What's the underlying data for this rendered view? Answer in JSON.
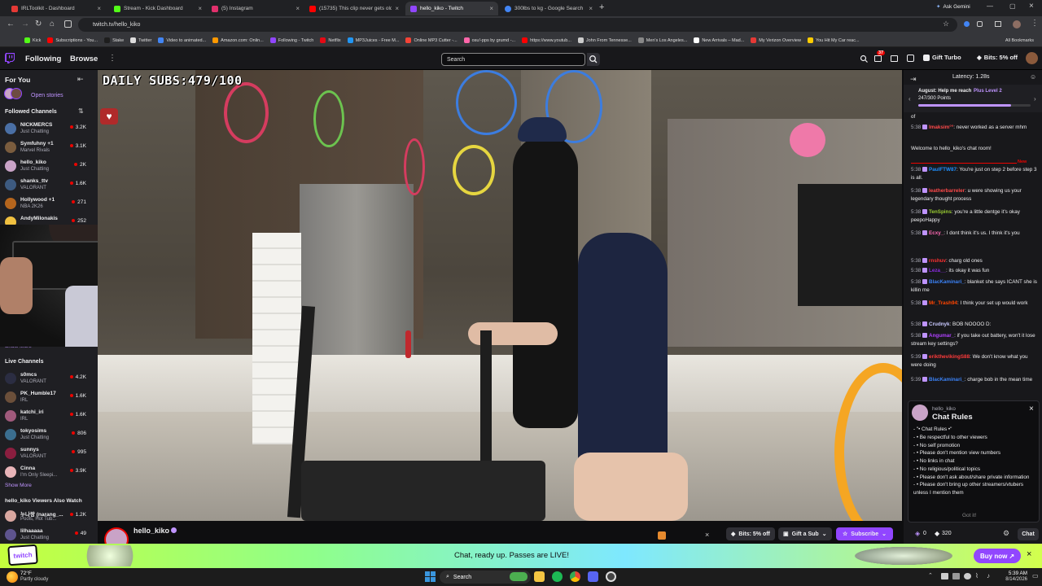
{
  "browser": {
    "tabs": [
      {
        "title": "IRLToolkit - Dashboard",
        "color": "#e53935"
      },
      {
        "title": "Stream - Kick Dashboard",
        "color": "#53fc18"
      },
      {
        "title": "(5) Instagram",
        "color": "#e1306c"
      },
      {
        "title": "(15735) This clip never gets old",
        "color": "#ff0000"
      },
      {
        "title": "hello_kiko - Twitch",
        "color": "#9146ff"
      },
      {
        "title": "300lbs to kg - Google Search",
        "color": "#4285f4"
      }
    ],
    "ask_gemini": "Ask Gemini",
    "url": "twitch.tv/hello_kiko",
    "bookmarks": [
      "Kick",
      "Subscriptions - You...",
      "Stake",
      "Twitter",
      "Video to animated...",
      "Amazon.com: Onlin...",
      "Following - Twitch",
      "Netflix",
      "MP3Juices - Free M...",
      "Online MP3 Cutter -...",
      "osu!-pps by grumd -...",
      "https://www.youtub...",
      "John From Tennesse...",
      "Men's Los Angeles...",
      "New Arrivals – Mad...",
      "My Verizon Overview",
      "You Hit My Car reac..."
    ],
    "all_bookmarks": "All Bookmarks"
  },
  "twitch_nav": {
    "following": "Following",
    "browse": "Browse",
    "search_placeholder": "Search",
    "notification_count": "37",
    "gift_turbo": "Gift Turbo",
    "bits_offer": "Bits: 5% off"
  },
  "sidebar": {
    "for_you": "For You",
    "open_stories": "Open stories",
    "followed_channels": "Followed Channels",
    "followed": [
      {
        "name": "NICKMERCS",
        "game": "Just Chatting",
        "viewers": "3.2K",
        "color": "#4a6fa5"
      },
      {
        "name": "Symfuhny +1",
        "game": "Marvel Rivals",
        "viewers": "3.1K",
        "color": "#7a5c3e"
      },
      {
        "name": "hello_kiko",
        "game": "Just Chatting",
        "viewers": "2K",
        "color": "#c9a3c7"
      },
      {
        "name": "shanks_ttv",
        "game": "VALORANT",
        "viewers": "1.6K",
        "color": "#3d5a80"
      },
      {
        "name": "Hollywood +1",
        "game": "NBA 2K26",
        "viewers": "271",
        "color": "#b5651d"
      },
      {
        "name": "AndyMilonakis",
        "game": "",
        "viewers": "252",
        "color": "#f0c040"
      }
    ],
    "show_more": "Show More",
    "live_channels": "Live Channels",
    "live": [
      {
        "name": "s0mcs",
        "game": "VALORANT",
        "viewers": "4.2K",
        "color": "#2b2d42"
      },
      {
        "name": "PK_Humble17",
        "game": "IRL",
        "viewers": "1.6K",
        "color": "#6b4f3a"
      },
      {
        "name": "katchi_iri",
        "game": "IRL",
        "viewers": "1.6K",
        "color": "#a05a7c"
      },
      {
        "name": "tokyosims",
        "game": "Just Chatting",
        "viewers": "806",
        "color": "#3b6e8f"
      },
      {
        "name": "sunnys",
        "game": "VALORANT",
        "viewers": "995",
        "color": "#8b1e3f"
      },
      {
        "name": "Cinna",
        "game": "I'm Only Sleepi...",
        "viewers": "3.9K",
        "color": "#e8b4b8"
      }
    ],
    "show_more_2": "Show More",
    "viewers_also_watch": "hello_kiko Viewers Also Watch",
    "also": [
      {
        "name": "누나랑 (narang_...",
        "game": "Pools, Hot Tub...",
        "viewers": "1.2K",
        "color": "#d9a7a0"
      },
      {
        "name": "lilhaaaaa",
        "game": "Just Chatting",
        "viewers": "49",
        "color": "#5e548e"
      }
    ]
  },
  "video": {
    "overlay_subs": "DAILY SUBS:479/100"
  },
  "stream_info": {
    "channel": "hello_kiko",
    "bits_offer": "Bits: 5% off",
    "gift_sub": "Gift a Sub",
    "subscribe": "Subscribe"
  },
  "chat": {
    "latency": "Latency: 1.28s",
    "goal_title": "August: Help me reach",
    "goal_level": "Plus Level 2",
    "goal_points": "247/300 Points",
    "goal_progress": 0.823,
    "of": "of",
    "messages": [
      {
        "time": "5:38",
        "user": "lmaksim°°",
        "color": "#ff4a4a",
        "text": ": never worked as a server mhm"
      },
      {
        "time": "",
        "user": "",
        "color": "#efeff1",
        "text": "Welcome to hello_kiko's chat room!"
      },
      {
        "time": "5:38",
        "user": "PaulFTW87",
        "color": "#1e90ff",
        "text": ": You're just on step 2 before step 3 is all."
      },
      {
        "time": "5:38",
        "user": "leatherbarreler",
        "color": "#ff4a4a",
        "text": ": u were showing us your legendary thought process"
      },
      {
        "time": "5:38",
        "user": "TenSpins",
        "color": "#9acd32",
        "text": ": you're a little dentge it's okay peepoHappy"
      },
      {
        "time": "5:38",
        "user": "Ecxy_",
        "color": "#ff69b4",
        "text": ": I dont think it's us. I think it's you"
      },
      {
        "time": "5:38",
        "user": "rnshuv",
        "color": "#ff3030",
        "text": ": charg old ones"
      },
      {
        "time": "5:38",
        "user": "Leza__",
        "color": "#8a2be2",
        "text": ": its okay it was fun"
      },
      {
        "time": "5:38",
        "user": "BlacKaminari_",
        "color": "#3b82f6",
        "text": ": blanket she says ICANT she is killin me"
      },
      {
        "time": "5:38",
        "user": "Mr_Trash94",
        "color": "#ff4500",
        "text": ": I think your set up would work"
      },
      {
        "time": "5:38",
        "user": "Crudnyk",
        "color": "#c9c9ff",
        "text": ": BOB NOOOO D:"
      },
      {
        "time": "5:38",
        "user": "Angumar_",
        "color": "#b041ff",
        "text": ": if you take out battery, won't it lose stream key settings?"
      },
      {
        "time": "5:39",
        "user": "erikthevikingS88",
        "color": "#ff3b3b",
        "text": ": We don't know what you were doing"
      },
      {
        "time": "5:39",
        "user": "BlacKaminari_",
        "color": "#3b82f6",
        "text": ": charge bob in the mean time"
      }
    ],
    "new_label": "New",
    "rules_channel": "hello_kiko",
    "rules_title": "Chat Rules",
    "rules": [
      "- \"• Chat Rules •\"",
      "-  •  Be respectful to other viewers",
      "-  •  No self promotion",
      "-  •  Please don't mention view numbers",
      "-  •  No links in chat",
      "-  •  No religious/political topics",
      "-  •  Please don't ask about/share private information",
      "-  •  Please don't bring up other streamers/vtubers unless I mention them"
    ],
    "got_it": "Got it!",
    "points": "0",
    "bits": "320",
    "chat_button": "Chat"
  },
  "banner": {
    "text": "Chat, ready up. Passes are LIVE!",
    "button": "Buy now ↗"
  },
  "taskbar": {
    "temp": "72°F",
    "weather": "Partly cloudy",
    "search": "Search",
    "time": "5:39 AM",
    "date": "8/14/2026"
  }
}
